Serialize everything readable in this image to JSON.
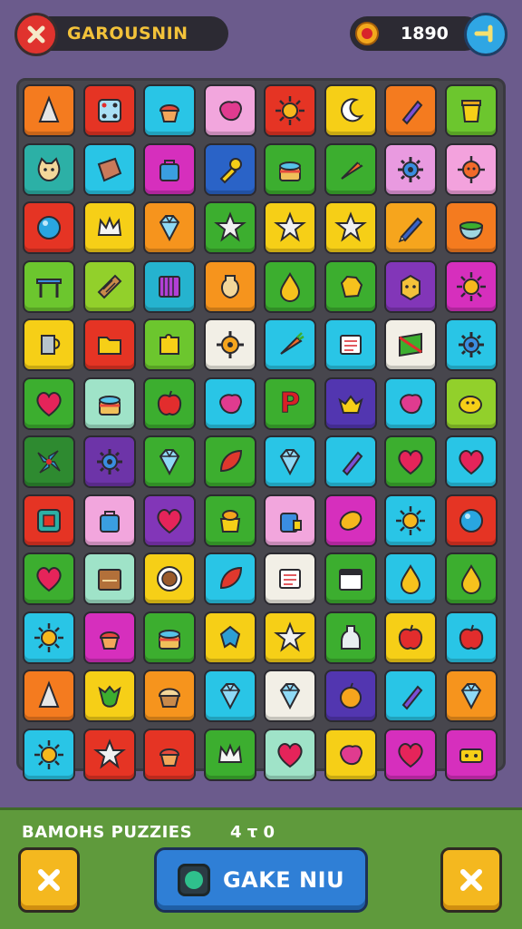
{
  "header": {
    "title": "GAROUSNIN",
    "score": "1890"
  },
  "footer": {
    "label": "BAMOHS PUZZIES",
    "count": "4 τ 0",
    "game_button_label": "GAKE NIU"
  },
  "board": {
    "tiles": [
      [
        {
          "color": "#f47b1f",
          "icon": "cone-icon"
        },
        {
          "color": "#e53424",
          "icon": "dice-icon"
        },
        {
          "color": "#29c5e6",
          "icon": "cupcake-icon"
        },
        {
          "color": "#f2a6dd",
          "icon": "blob-icon"
        },
        {
          "color": "#e53424",
          "icon": "sun-icon"
        },
        {
          "color": "#f6cf17",
          "icon": "moon-icon"
        },
        {
          "color": "#f47b1f",
          "icon": "crystal-icon"
        },
        {
          "color": "#6cc62e",
          "icon": "honey-pot-icon"
        }
      ],
      [
        {
          "color": "#2cb0a6",
          "icon": "cat-face-icon"
        },
        {
          "color": "#29c5e6",
          "icon": "book-icon"
        },
        {
          "color": "#d62fbd",
          "icon": "bag-icon"
        },
        {
          "color": "#2a63c7",
          "icon": "brush-icon"
        },
        {
          "color": "#3cae2f",
          "icon": "cake-icon"
        },
        {
          "color": "#3cae2f",
          "icon": "carrot-icon"
        },
        {
          "color": "#e99ae0",
          "icon": "gear-icon"
        },
        {
          "color": "#f3a2dd",
          "icon": "sun-face-icon"
        }
      ],
      [
        {
          "color": "#e53424",
          "icon": "ball-icon"
        },
        {
          "color": "#f6cf17",
          "icon": "crown-icon"
        },
        {
          "color": "#f6941d",
          "icon": "gem-icon"
        },
        {
          "color": "#3cae2f",
          "icon": "star-icon"
        },
        {
          "color": "#f6cf17",
          "icon": "star-icon"
        },
        {
          "color": "#f6cf17",
          "icon": "star-icon"
        },
        {
          "color": "#f6a51d",
          "icon": "pencil-icon"
        },
        {
          "color": "#f47b1f",
          "icon": "bowl-icon"
        }
      ],
      [
        {
          "color": "#6cc62e",
          "icon": "table-icon"
        },
        {
          "color": "#92d02b",
          "icon": "scroll-icon"
        },
        {
          "color": "#25b3cf",
          "icon": "box-icon"
        },
        {
          "color": "#f6941d",
          "icon": "vase-icon"
        },
        {
          "color": "#3cae2f",
          "icon": "drop-icon"
        },
        {
          "color": "#3cae2f",
          "icon": "rock-icon"
        },
        {
          "color": "#8236b8",
          "icon": "cube-icon"
        },
        {
          "color": "#d62fbd",
          "icon": "sun-icon"
        }
      ],
      [
        {
          "color": "#f6cf17",
          "icon": "jug-icon"
        },
        {
          "color": "#e53424",
          "icon": "folder-icon"
        },
        {
          "color": "#6cc62e",
          "icon": "puzzle-icon"
        },
        {
          "color": "#f2efe6",
          "icon": "cog-icon"
        },
        {
          "color": "#29c5e6",
          "icon": "carrot-icon"
        },
        {
          "color": "#29c5e6",
          "icon": "notebook-icon"
        },
        {
          "color": "#f2efe6",
          "icon": "map-icon"
        },
        {
          "color": "#29c5e6",
          "icon": "gear-icon"
        }
      ],
      [
        {
          "color": "#3cae2f",
          "icon": "heart-icon"
        },
        {
          "color": "#9fe3c8",
          "icon": "cake-icon"
        },
        {
          "color": "#3cae2f",
          "icon": "apple-icon"
        },
        {
          "color": "#29c5e6",
          "icon": "blob-icon"
        },
        {
          "color": "#3cae2f",
          "icon": "letter-p-icon"
        },
        {
          "color": "#5236b0",
          "icon": "shell-icon"
        },
        {
          "color": "#29c5e6",
          "icon": "blob-icon"
        },
        {
          "color": "#92d02b",
          "icon": "fish-face-icon"
        }
      ],
      [
        {
          "color": "#2e8a30",
          "icon": "pinwheel-icon"
        },
        {
          "color": "#6d34a8",
          "icon": "gear-icon"
        },
        {
          "color": "#3cae2f",
          "icon": "gem-icon"
        },
        {
          "color": "#3cae2f",
          "icon": "leaf-icon"
        },
        {
          "color": "#29c5e6",
          "icon": "gem-icon"
        },
        {
          "color": "#29c5e6",
          "icon": "crystal-icon"
        },
        {
          "color": "#3cae2f",
          "icon": "heart-icon"
        },
        {
          "color": "#29c5e6",
          "icon": "heart-icon"
        }
      ],
      [
        {
          "color": "#e53424",
          "icon": "frame-icon"
        },
        {
          "color": "#f2a6dd",
          "icon": "bag-icon"
        },
        {
          "color": "#8236b8",
          "icon": "heart-icon"
        },
        {
          "color": "#3cae2f",
          "icon": "pot-icon"
        },
        {
          "color": "#f2a6dd",
          "icon": "jar-icon"
        },
        {
          "color": "#d62fbd",
          "icon": "lemon-icon"
        },
        {
          "color": "#29c5e6",
          "icon": "sun-icon"
        },
        {
          "color": "#e53424",
          "icon": "ball-icon"
        }
      ],
      [
        {
          "color": "#3cae2f",
          "icon": "heart-icon"
        },
        {
          "color": "#9fe3c8",
          "icon": "crate-icon"
        },
        {
          "color": "#f6cf17",
          "icon": "coin-icon"
        },
        {
          "color": "#29c5e6",
          "icon": "leaf-icon"
        },
        {
          "color": "#f2efe6",
          "icon": "notebook-icon"
        },
        {
          "color": "#3cae2f",
          "icon": "calendar-icon"
        },
        {
          "color": "#29c5e6",
          "icon": "drop-icon"
        },
        {
          "color": "#3cae2f",
          "icon": "drop-icon"
        }
      ],
      [
        {
          "color": "#29c5e6",
          "icon": "sun-icon"
        },
        {
          "color": "#d62fbd",
          "icon": "cupcake-icon"
        },
        {
          "color": "#3cae2f",
          "icon": "cake-icon"
        },
        {
          "color": "#f6cf17",
          "icon": "bird-icon"
        },
        {
          "color": "#f6cf17",
          "icon": "star-icon"
        },
        {
          "color": "#3cae2f",
          "icon": "bottle-icon"
        },
        {
          "color": "#f6cf17",
          "icon": "apple-icon"
        },
        {
          "color": "#29c5e6",
          "icon": "apple-icon"
        }
      ],
      [
        {
          "color": "#f47b1f",
          "icon": "cone-icon"
        },
        {
          "color": "#f6cf17",
          "icon": "leaf-face-icon"
        },
        {
          "color": "#f6941d",
          "icon": "muffin-icon"
        },
        {
          "color": "#29c5e6",
          "icon": "gem-icon"
        },
        {
          "color": "#f2efe6",
          "icon": "gem-icon"
        },
        {
          "color": "#5236b0",
          "icon": "orange-icon"
        },
        {
          "color": "#29c5e6",
          "icon": "crystal-icon"
        },
        {
          "color": "#f6941d",
          "icon": "gem-icon"
        }
      ],
      [
        {
          "color": "#29c5e6",
          "icon": "sun-icon"
        },
        {
          "color": "#e53424",
          "icon": "star-icon"
        },
        {
          "color": "#e53424",
          "icon": "cupcake-icon"
        },
        {
          "color": "#3cae2f",
          "icon": "crown-icon"
        },
        {
          "color": "#9fe3c8",
          "icon": "heart-icon"
        },
        {
          "color": "#f6cf17",
          "icon": "blob-icon"
        },
        {
          "color": "#d62fbd",
          "icon": "heart-icon"
        },
        {
          "color": "#d62fbd",
          "icon": "toy-icon"
        }
      ]
    ]
  },
  "colors": {
    "background": "#6b5b8c",
    "title_accent": "#f3c23a",
    "close_button": "#e0332e",
    "next_button": "#2fa6e4",
    "footer": "#5f9a3c",
    "game_button": "#2f7fd6",
    "yellow_button": "#f4b81f"
  },
  "icons": {
    "close": "close-icon",
    "coin": "coin-icon",
    "next": "arrow-right-icon",
    "gem": "gem-icon"
  }
}
